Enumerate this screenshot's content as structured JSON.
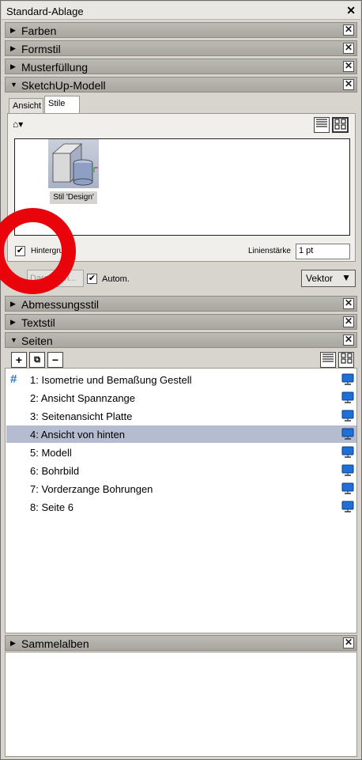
{
  "window": {
    "title": "Standard-Ablage",
    "close_glyph": "✕"
  },
  "sections": [
    {
      "label": "Farben",
      "expanded": false
    },
    {
      "label": "Formstil",
      "expanded": false
    },
    {
      "label": "Musterfüllung",
      "expanded": false
    },
    {
      "label": "SketchUp-Modell",
      "expanded": true
    },
    {
      "label": "Abmessungsstil",
      "expanded": false
    },
    {
      "label": "Textstil",
      "expanded": false
    },
    {
      "label": "Seiten",
      "expanded": true
    },
    {
      "label": "Sammelalben",
      "expanded": false
    }
  ],
  "sketchup": {
    "tabs": [
      "Ansicht",
      "Stile"
    ],
    "active_tab": "Stile",
    "style_label": "Stil 'Design'",
    "background_checkbox": {
      "label": "Hintergrund",
      "checked": true
    },
    "line_weight": {
      "label": "Linienstärke",
      "value": "1 pt"
    },
    "render_button": "Darstellen...",
    "auto_checkbox": {
      "label": "Autom.",
      "checked": true
    },
    "render_mode": "Vektor"
  },
  "pages": {
    "items": [
      {
        "num": "1:",
        "name": "Isometrie und Bemaßung Gestell",
        "current": true,
        "selected": false
      },
      {
        "num": "2:",
        "name": "Ansicht Spannzange",
        "current": false,
        "selected": false
      },
      {
        "num": "3:",
        "name": "Seitenansicht Platte",
        "current": false,
        "selected": false
      },
      {
        "num": "4:",
        "name": "Ansicht von hinten",
        "current": false,
        "selected": true
      },
      {
        "num": "5:",
        "name": "Modell",
        "current": false,
        "selected": false
      },
      {
        "num": "6:",
        "name": "Bohrbild",
        "current": false,
        "selected": false
      },
      {
        "num": "7:",
        "name": "Vorderzange Bohrungen",
        "current": false,
        "selected": false
      },
      {
        "num": "8:",
        "name": "Seite 6",
        "current": false,
        "selected": false
      }
    ]
  },
  "colors": {
    "selected_row": "#b6bccf",
    "annotation_ring": "#e8040a",
    "hash_mark": "#2f74c4"
  }
}
